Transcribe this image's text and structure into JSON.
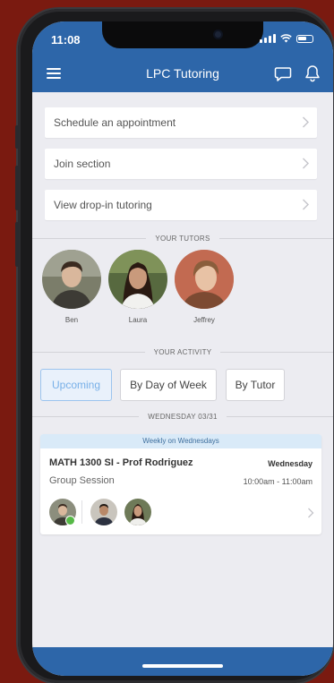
{
  "status_bar": {
    "time": "11:08"
  },
  "header": {
    "title": "LPC Tutoring"
  },
  "menu_items": [
    {
      "label": "Schedule an appointment"
    },
    {
      "label": "Join section"
    },
    {
      "label": "View drop-in tutoring"
    }
  ],
  "tutors_section": {
    "header": "YOUR TUTORS",
    "tutors": [
      {
        "name": "Ben"
      },
      {
        "name": "Laura"
      },
      {
        "name": "Jeffrey"
      }
    ]
  },
  "activity_section": {
    "header": "YOUR ACTIVITY",
    "tabs": [
      {
        "label": "Upcoming",
        "active": true
      },
      {
        "label": "By Day of Week",
        "active": false
      },
      {
        "label": "By Tutor",
        "active": false
      }
    ]
  },
  "date_header": "WEDNESDAY 03/31",
  "session": {
    "banner": "Weekly on Wednesdays",
    "title": "MATH 1300 SI - Prof Rodriguez",
    "day": "Wednesday",
    "type": "Group Session",
    "time": "10:00am - 11:00am"
  },
  "colors": {
    "header_blue": "#2d66a9",
    "background": "#7a1a10",
    "active_tab": "#78b0e8"
  }
}
